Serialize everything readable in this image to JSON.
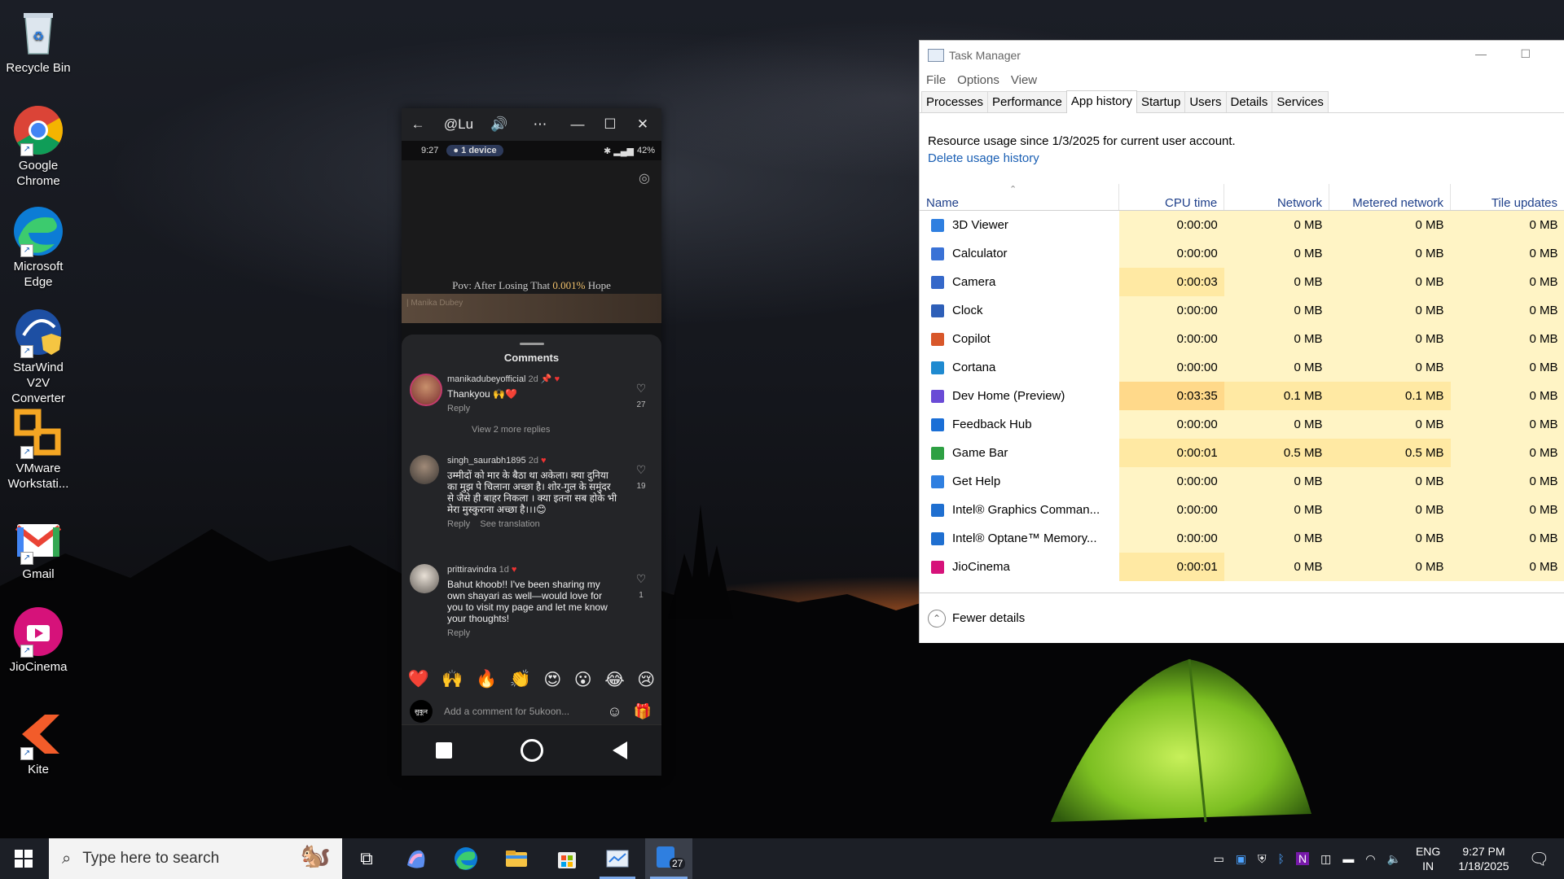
{
  "desktop": {
    "icons": [
      {
        "label": "Recycle Bin"
      },
      {
        "label": "Google Chrome"
      },
      {
        "label": "Microsoft Edge"
      },
      {
        "label": "StarWind V2V Converter"
      },
      {
        "label": "VMware Workstati..."
      },
      {
        "label": "Gmail"
      },
      {
        "label": "JioCinema"
      },
      {
        "label": "Kite"
      }
    ]
  },
  "phone_window": {
    "title": "@Lu",
    "status_time": "9:27",
    "status_device": "1 device",
    "status_battery": "42%",
    "video_caption_pre": "Pov: After Losing That ",
    "video_caption_highlight": "0.001%",
    "video_caption_post": " Hope",
    "video_watermark": "| Manika Dubey",
    "comments_header": "Comments",
    "comments": [
      {
        "user": "manikadubeyofficial",
        "time": "2d",
        "text": "Thankyou 🙌❤️",
        "reply": "Reply",
        "likes": "27",
        "more": "View 2 more replies"
      },
      {
        "user": "singh_saurabh1895",
        "time": "2d",
        "text": "उम्मीदों को मार के बैठा था अकेला। क्या दुनिया का मुझ पे चिलाना अच्छा है। शोर-गुल के समुंदर से जैसे ही बाहर निकला । क्या इतना सब होके भी मेरा मुस्कुराना अच्छा है।।।😊",
        "reply": "Reply",
        "translate": "See translation",
        "likes": "19"
      },
      {
        "user": "prittiravindra",
        "time": "1d",
        "text": "Bahut khoob!! I've been sharing my own shayari as well—would love for you to visit my page and let me know your thoughts!",
        "reply": "Reply",
        "likes": "1"
      }
    ],
    "reactions": [
      "❤️",
      "🙌",
      "🔥",
      "👏",
      "😍",
      "😮",
      "😂",
      "😢"
    ],
    "comment_placeholder": "Add a comment for 5ukoon...",
    "avatar_badge": "सुकून"
  },
  "task_manager": {
    "title": "Task Manager",
    "menu": [
      "File",
      "Options",
      "View"
    ],
    "tabs": [
      "Processes",
      "Performance",
      "App history",
      "Startup",
      "Users",
      "Details",
      "Services"
    ],
    "active_tab": "App history",
    "info": "Resource usage since 1/3/2025 for current user account.",
    "delete_link": "Delete usage history",
    "columns": [
      "Name",
      "CPU time",
      "Network",
      "Metered network",
      "Tile updates"
    ],
    "rows": [
      {
        "name": "3D Viewer",
        "cpu": "0:00:00",
        "net": "0 MB",
        "metered": "0 MB",
        "tile": "0 MB"
      },
      {
        "name": "Calculator",
        "cpu": "0:00:00",
        "net": "0 MB",
        "metered": "0 MB",
        "tile": "0 MB"
      },
      {
        "name": "Camera",
        "cpu": "0:00:03",
        "net": "0 MB",
        "metered": "0 MB",
        "tile": "0 MB"
      },
      {
        "name": "Clock",
        "cpu": "0:00:00",
        "net": "0 MB",
        "metered": "0 MB",
        "tile": "0 MB"
      },
      {
        "name": "Copilot",
        "cpu": "0:00:00",
        "net": "0 MB",
        "metered": "0 MB",
        "tile": "0 MB"
      },
      {
        "name": "Cortana",
        "cpu": "0:00:00",
        "net": "0 MB",
        "metered": "0 MB",
        "tile": "0 MB"
      },
      {
        "name": "Dev Home (Preview)",
        "cpu": "0:03:35",
        "net": "0.1 MB",
        "metered": "0.1 MB",
        "tile": "0 MB"
      },
      {
        "name": "Feedback Hub",
        "cpu": "0:00:00",
        "net": "0 MB",
        "metered": "0 MB",
        "tile": "0 MB"
      },
      {
        "name": "Game Bar",
        "cpu": "0:00:01",
        "net": "0.5 MB",
        "metered": "0.5 MB",
        "tile": "0 MB"
      },
      {
        "name": "Get Help",
        "cpu": "0:00:00",
        "net": "0 MB",
        "metered": "0 MB",
        "tile": "0 MB"
      },
      {
        "name": "Intel® Graphics Comman...",
        "cpu": "0:00:00",
        "net": "0 MB",
        "metered": "0 MB",
        "tile": "0 MB"
      },
      {
        "name": "Intel® Optane™ Memory...",
        "cpu": "0:00:00",
        "net": "0 MB",
        "metered": "0 MB",
        "tile": "0 MB"
      },
      {
        "name": "JioCinema",
        "cpu": "0:00:01",
        "net": "0 MB",
        "metered": "0 MB",
        "tile": "0 MB"
      }
    ],
    "footer": "Fewer details"
  },
  "taskbar": {
    "search_placeholder": "Type here to search",
    "badge_count": "27",
    "lang_top": "ENG",
    "lang_bottom": "IN",
    "time": "9:27 PM",
    "date": "1/18/2025"
  },
  "colors": {
    "accent": "#1a5fb4",
    "highlight_light": "#fff4c5",
    "highlight_mid": "#ffe9a3",
    "highlight_strong": "#ffd98a"
  }
}
